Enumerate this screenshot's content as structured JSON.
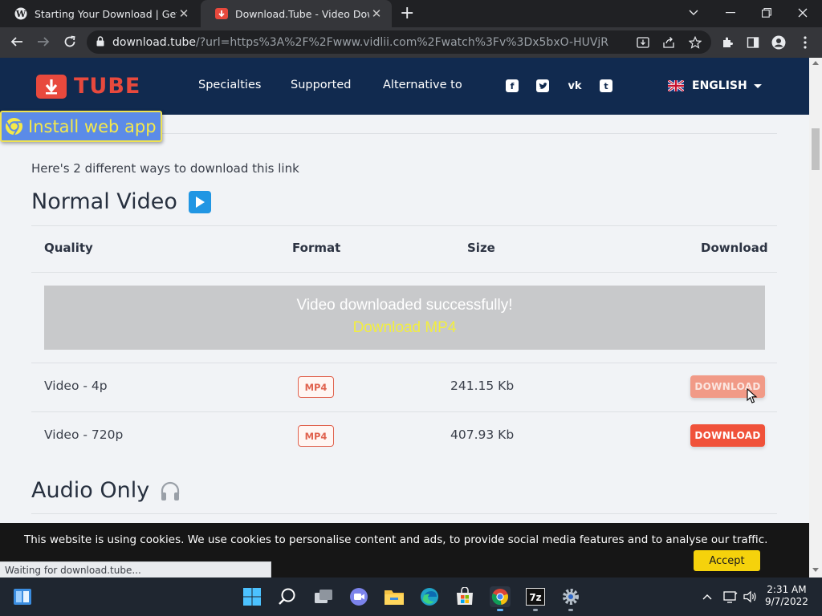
{
  "browser": {
    "tabs": [
      {
        "title": "Starting Your Download | Get Into",
        "active": false
      },
      {
        "title": "Download.Tube - Video Downloader",
        "active": true
      }
    ],
    "url_host": "download.tube",
    "url_path": "/?url=https%3A%2F%2Fwww.vidlii.com%2Fwatch%3Fv%3Dx5bxO-HUVjR",
    "status_text": "Waiting for download.tube..."
  },
  "site": {
    "logo_text": "TUBE",
    "nav": [
      "Specialties",
      "Supported",
      "Alternative to"
    ],
    "social": [
      "facebook-icon",
      "twitter-icon",
      "vk-icon",
      "tumblr-icon"
    ],
    "language": "ENGLISH",
    "install_label": "Install web app"
  },
  "main": {
    "intro": "Here's 2 different ways to download this link",
    "normal_heading": "Normal Video",
    "audio_heading": "Audio Only",
    "columns": [
      "Quality",
      "Format",
      "Size",
      "Download"
    ],
    "banner_message": "Video downloaded successfully!",
    "banner_link": "Download MP4",
    "rows": [
      {
        "quality": "Video - 4p",
        "format": "MP4",
        "size": "241.15 Kb",
        "action": "DOWNLOAD"
      },
      {
        "quality": "Video - 720p",
        "format": "MP4",
        "size": "407.93 Kb",
        "action": "DOWNLOAD"
      }
    ]
  },
  "cookie": {
    "text": "This website is using cookies. We use cookies to personalise content and ads, to provide social media features and to analyse our traffic.",
    "accept": "Accept"
  },
  "taskbar": {
    "time": "2:31 AM",
    "date": "9/7/2022"
  },
  "colors": {
    "header_bg": "#112a4f",
    "accent": "#f0523a",
    "install_bg": "#5b8be8",
    "cookie_accept": "#f5d20c"
  }
}
